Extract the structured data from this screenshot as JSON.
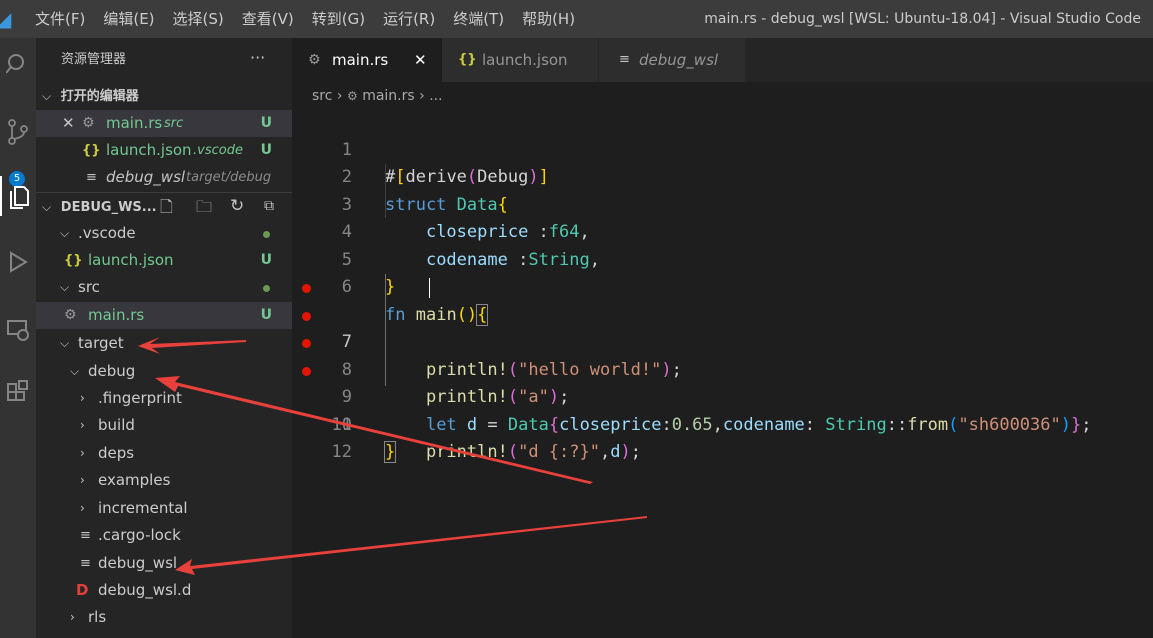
{
  "window": {
    "title": "main.rs - debug_wsl [WSL: Ubuntu-18.04] - Visual Studio Code"
  },
  "menu": [
    "文件(F)",
    "编辑(E)",
    "选择(S)",
    "查看(V)",
    "转到(G)",
    "运行(R)",
    "终端(T)",
    "帮助(H)"
  ],
  "activity": {
    "scm_badge": "5"
  },
  "sidebar": {
    "title": "资源管理器",
    "more": "···",
    "open_editors_header": "打开的编辑器",
    "open_editors": [
      {
        "name": "main.rs",
        "desc": "src",
        "status": "U"
      },
      {
        "name": "launch.json",
        "desc": ".vscode",
        "status": "U"
      },
      {
        "name": "debug_wsl",
        "desc": "target/debug",
        "status": ""
      }
    ],
    "project_header": "DEBUG_WS...",
    "tree": {
      "vscode": ".vscode",
      "launch": "launch.json",
      "launch_status": "U",
      "src": "src",
      "main": "main.rs",
      "main_status": "U",
      "target": "target",
      "debug": "debug",
      "fingerprint": ".fingerprint",
      "build": "build",
      "deps": "deps",
      "examples": "examples",
      "incremental": "incremental",
      "cargo_lock": ".cargo-lock",
      "debug_wsl": "debug_wsl",
      "debug_wsl_d": "debug_wsl.d",
      "rls": "rls"
    }
  },
  "tabs": [
    {
      "label": "main.rs",
      "close": "✕"
    },
    {
      "label": "launch.json"
    },
    {
      "label": "debug_wsl"
    }
  ],
  "breadcrumb": {
    "folder": "src",
    "sep1": "›",
    "file": "main.rs",
    "sep2": "›",
    "rest": "..."
  },
  "code": {
    "line_numbers": [
      "1",
      "2",
      "3",
      "4",
      "5",
      "6",
      "7",
      "8",
      "9",
      "10",
      "11",
      "12"
    ],
    "breakpoint_lines": [
      7,
      8,
      9,
      10
    ],
    "current_line": 7
  },
  "colors": {
    "accent": "#007acc",
    "breakpoint": "#e51400",
    "arrow": "#e8403a"
  }
}
